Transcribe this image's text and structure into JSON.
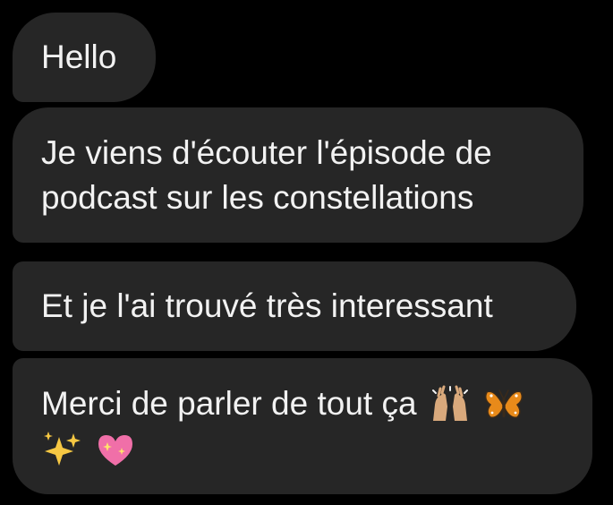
{
  "messages": [
    {
      "text": "Hello"
    },
    {
      "text": "Je viens d'écouter l'épisode de podcast sur les constellations"
    },
    {
      "text": "Et je l'ai trouvé très interessant"
    },
    {
      "text": "Merci de parler de tout ça",
      "emojis_line1": [
        "raising-hands-emoji",
        "butterfly-emoji"
      ],
      "emojis_line2": [
        "sparkles-emoji",
        "sparkling-heart-emoji"
      ]
    }
  ],
  "colors": {
    "background": "#000000",
    "bubble": "#262626",
    "text": "#f2f2f2"
  }
}
